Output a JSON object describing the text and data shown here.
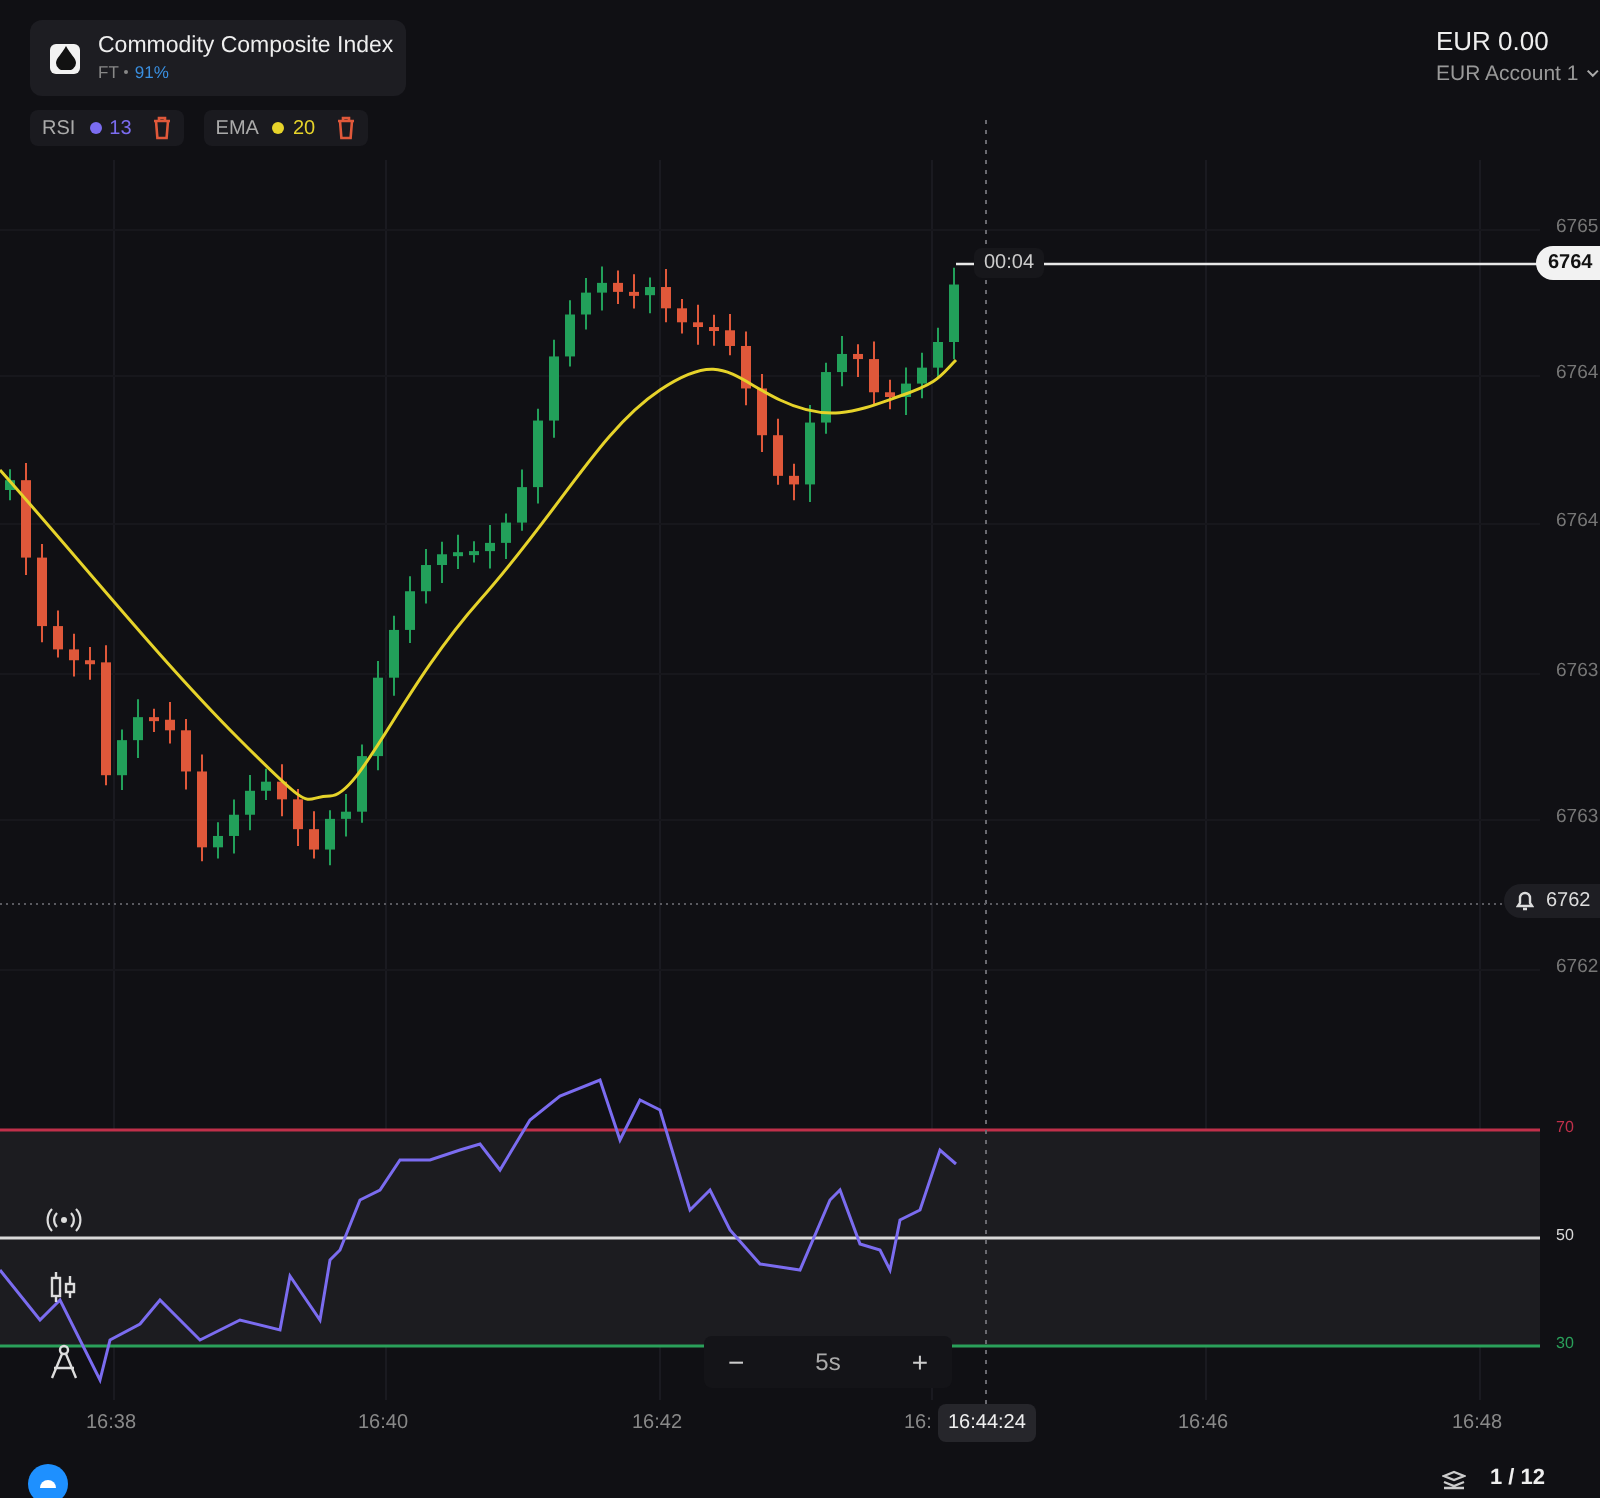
{
  "instrument": {
    "name": "Commodity Composite Index",
    "market": "FT",
    "payout": "91%"
  },
  "indicators": [
    {
      "name": "RSI",
      "period": "13",
      "color": "#7b6cf0"
    },
    {
      "name": "EMA",
      "period": "20",
      "color": "#e6d32a"
    }
  ],
  "account": {
    "balance": "EUR 0.00",
    "name": "EUR Account 1"
  },
  "price_axis": [
    {
      "label": "6765",
      "kind": "tick"
    },
    {
      "label": "6764",
      "kind": "current"
    },
    {
      "label": "6764",
      "kind": "tick"
    },
    {
      "label": "6764",
      "kind": "tick"
    },
    {
      "label": "6763",
      "kind": "tick"
    },
    {
      "label": "6763",
      "kind": "tick"
    },
    {
      "label": "6762",
      "kind": "alert"
    },
    {
      "label": "6762",
      "kind": "tick"
    }
  ],
  "countdown": "00:04",
  "rsi_levels": [
    "70",
    "50",
    "30"
  ],
  "time_axis": [
    "16:38",
    "16:40",
    "16:42",
    "16:",
    "16:46",
    "16:48"
  ],
  "crosshair_time": "16:44:24",
  "timeframe": {
    "value": "5s",
    "decrease": "−",
    "increase": "+"
  },
  "pager": "1 / 12"
}
